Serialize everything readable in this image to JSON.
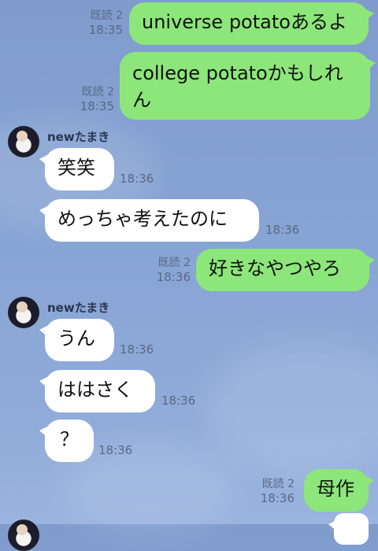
{
  "messages": {
    "m1": {
      "text": "universe potatoあるよ",
      "read": "既読 2",
      "time": "18:35"
    },
    "m2": {
      "text_line1": "college potatoかもしれ",
      "text_line2": "ん",
      "read": "既読 2",
      "time": "18:35"
    },
    "sender1": {
      "name": "newたまき"
    },
    "m3": {
      "text": "笑笑",
      "time": "18:36"
    },
    "m4": {
      "text": "めっちゃ考えたのに",
      "time": "18:36"
    },
    "m5": {
      "text": "好きなやつやろ",
      "read": "既読 2",
      "time": "18:36"
    },
    "sender2": {
      "name": "newたまき"
    },
    "m6": {
      "text": "うん",
      "time": "18:36"
    },
    "m7": {
      "text": "ははさく",
      "time": "18:36"
    },
    "m8": {
      "text": "？",
      "time": "18:36"
    },
    "m9": {
      "text": "母作",
      "read": "既読 2",
      "time": "18:36"
    }
  },
  "colors": {
    "outgoing_bubble": "#8de67a",
    "incoming_bubble": "#ffffff",
    "background": "#86a4d4"
  }
}
